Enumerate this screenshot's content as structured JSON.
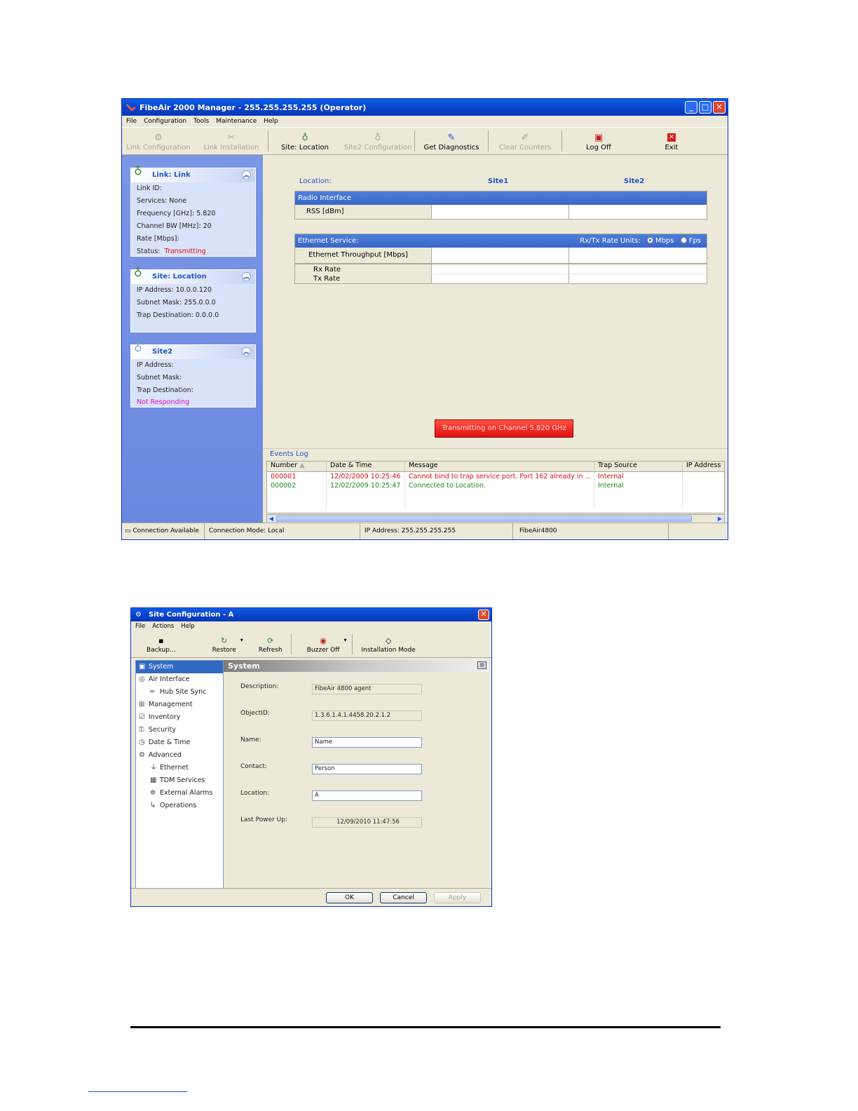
{
  "main": {
    "title": "FibeAir 2000 Manager - 255.255.255.255 (Operator)",
    "menu": [
      "File",
      "Configuration",
      "Tools",
      "Maintenance",
      "Help"
    ],
    "toolbar": [
      {
        "label": "Link Configuration",
        "icon": "wrench-icon",
        "enabled": false
      },
      {
        "label": "Link Installation",
        "icon": "tools-icon",
        "enabled": false
      },
      {
        "label": "Site: Location",
        "icon": "antenna-icon",
        "enabled": true
      },
      {
        "label": "Site2 Configuration",
        "icon": "antenna-icon",
        "enabled": false
      },
      {
        "label": "Get Diagnostics",
        "icon": "diagnostics-icon",
        "enabled": true
      },
      {
        "label": "Clear Counters",
        "icon": "eraser-icon",
        "enabled": false
      },
      {
        "label": "Log Off",
        "icon": "log-off-icon",
        "enabled": true
      },
      {
        "label": "Exit",
        "icon": "exit-icon",
        "enabled": true
      }
    ],
    "link_panel": {
      "title": "Link: Link",
      "rows": [
        "Link ID:",
        "Services:  None",
        "Frequency [GHz]:  5.820",
        "Channel BW [MHz]:  20",
        "Rate [Mbps]:"
      ],
      "status_label": "Status:",
      "status_value": "Transmitting"
    },
    "site1_panel": {
      "title": "Site: Location",
      "rows": [
        "IP Address:  10.0.0.120",
        "Subnet Mask:  255.0.0.0",
        "Trap Destination:  0.0.0.0"
      ]
    },
    "site2_panel": {
      "title": "Site2",
      "rows": [
        "IP Address:",
        "Subnet Mask:",
        "Trap Destination:"
      ],
      "status": "Not Responding"
    },
    "location_label": "Location:",
    "site1": "Site1",
    "site2": "Site2",
    "radio_header": "Radio Interface",
    "rss_label": "RSS [dBm]",
    "ethernet_header": "Ethernet Service:",
    "rate_units_label": "Rx/Tx Rate Units:",
    "rate_unit_mbps": "Mbps",
    "rate_unit_fps": "Fps",
    "throughput_label": "Ethernet Throughput [Mbps]",
    "rx_rate": "Rx Rate",
    "tx_rate": "Tx Rate",
    "transmit_status": "Transmitting on Channel 5.820 GHz",
    "events": {
      "title": "Events Log",
      "columns": [
        "Number",
        "Date & Time",
        "Message",
        "Trap Source",
        "IP Address"
      ],
      "rows": [
        {
          "number": "000001",
          "datetime": "12/02/2009 10:25:46",
          "message": "Cannot bind to trap service port. Port 162 already in ...",
          "source": "Internal",
          "color": "#d81010"
        },
        {
          "number": "000002",
          "datetime": "12/02/2009 10:25:47",
          "message": "Connected to Location.",
          "source": "Internal",
          "color": "#1a8a1a"
        }
      ]
    },
    "statusbar": [
      "Connection Available",
      "Connection Mode: Local",
      "IP Address: 255.255.255.255",
      "FibeAir4800"
    ]
  },
  "site_config": {
    "title": "Site Configuration - A",
    "menu": [
      "File",
      "Actions",
      "Help"
    ],
    "toolbar": [
      {
        "label": "Backup...",
        "icon": "floppy-icon",
        "dropdown": false
      },
      {
        "label": "Restore",
        "icon": "restore-icon",
        "dropdown": true
      },
      {
        "label": "Refresh",
        "icon": "refresh-icon",
        "dropdown": false
      },
      {
        "label": "Buzzer Off",
        "icon": "buzzer-icon",
        "dropdown": true
      },
      {
        "label": "Installation Mode",
        "icon": "installation-icon",
        "dropdown": false
      }
    ],
    "tree": [
      {
        "label": "System",
        "icon": "system-icon",
        "selected": true,
        "sub": false
      },
      {
        "label": "Air Interface",
        "icon": "air-interface-icon",
        "selected": false,
        "sub": false
      },
      {
        "label": "Hub Site Sync",
        "icon": "sync-icon",
        "selected": false,
        "sub": true
      },
      {
        "label": "Management",
        "icon": "management-icon",
        "selected": false,
        "sub": false
      },
      {
        "label": "Inventory",
        "icon": "inventory-icon",
        "selected": false,
        "sub": false
      },
      {
        "label": "Security",
        "icon": "security-icon",
        "selected": false,
        "sub": false
      },
      {
        "label": "Date & Time",
        "icon": "clock-icon",
        "selected": false,
        "sub": false
      },
      {
        "label": "Advanced",
        "icon": "gear-icon",
        "selected": false,
        "sub": false
      },
      {
        "label": "Ethernet",
        "icon": "ethernet-icon",
        "selected": false,
        "sub": true
      },
      {
        "label": "TDM Services",
        "icon": "tdm-icon",
        "selected": false,
        "sub": true
      },
      {
        "label": "External Alarms",
        "icon": "alarm-icon",
        "selected": false,
        "sub": true
      },
      {
        "label": "Operations",
        "icon": "operations-icon",
        "selected": false,
        "sub": true
      }
    ],
    "section_title": "System",
    "fields": [
      {
        "label": "Description:",
        "value": "FibeAir 4800 agent",
        "editable": false
      },
      {
        "label": "ObjectID:",
        "value": "1.3.6.1.4.1.4458.20.2.1.2",
        "editable": false
      },
      {
        "label": "Name:",
        "value": "Name",
        "editable": true
      },
      {
        "label": "Contact:",
        "value": "Person",
        "editable": true
      },
      {
        "label": "Location:",
        "value": "A",
        "editable": true
      },
      {
        "label": "Last Power Up:",
        "value": "12/09/2010 11:47:56",
        "editable": false
      }
    ],
    "ok": "OK",
    "cancel": "Cancel",
    "apply": "Apply"
  }
}
